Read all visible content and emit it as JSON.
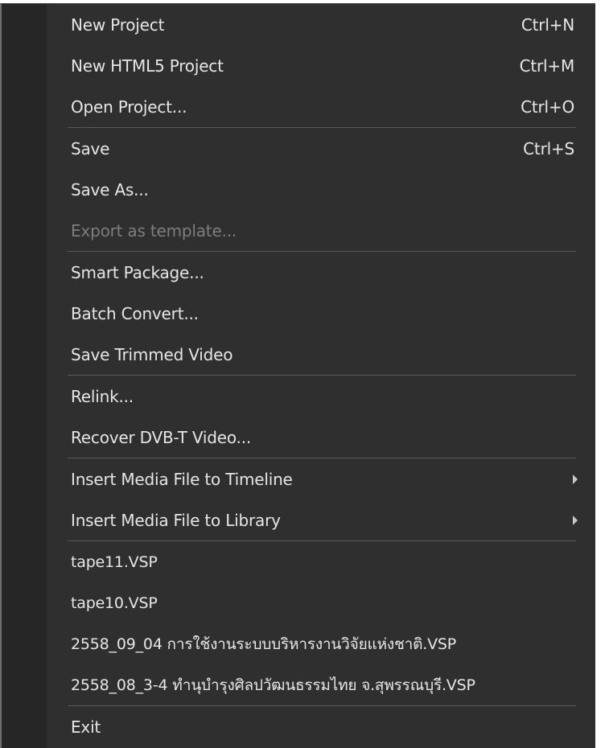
{
  "menu": {
    "group_project": [
      {
        "label": "New Project",
        "shortcut": "Ctrl+N"
      },
      {
        "label": "New HTML5 Project",
        "shortcut": "Ctrl+M"
      },
      {
        "label": "Open Project...",
        "shortcut": "Ctrl+O"
      }
    ],
    "group_save": [
      {
        "label": "Save",
        "shortcut": "Ctrl+S"
      },
      {
        "label": "Save As..."
      },
      {
        "label": "Export as template...",
        "disabled": true
      }
    ],
    "group_tools": [
      {
        "label": "Smart Package..."
      },
      {
        "label": "Batch Convert..."
      },
      {
        "label": "Save Trimmed Video"
      }
    ],
    "group_recover": [
      {
        "label": "Relink..."
      },
      {
        "label": "Recover DVB-T Video..."
      }
    ],
    "group_insert": [
      {
        "label": "Insert Media File to Timeline"
      },
      {
        "label": "Insert Media File to Library"
      }
    ],
    "recent_files": [
      "tape11.VSP",
      "tape10.VSP",
      "2558_09_04 การใช้งานระบบบริหารงานวิจัยแห่งชาติ.VSP",
      "2558_08_3-4 ทำนุบำรุงศิลปวัฒนธรรมไทย จ.สุพรรณบุรี.VSP"
    ],
    "exit": "Exit",
    "colors": {
      "background": "#2f2f2f",
      "gutter": "#262626",
      "text": "#e6e6e6",
      "disabled": "#7d7d7d",
      "separator": "#5a5a5a"
    }
  }
}
